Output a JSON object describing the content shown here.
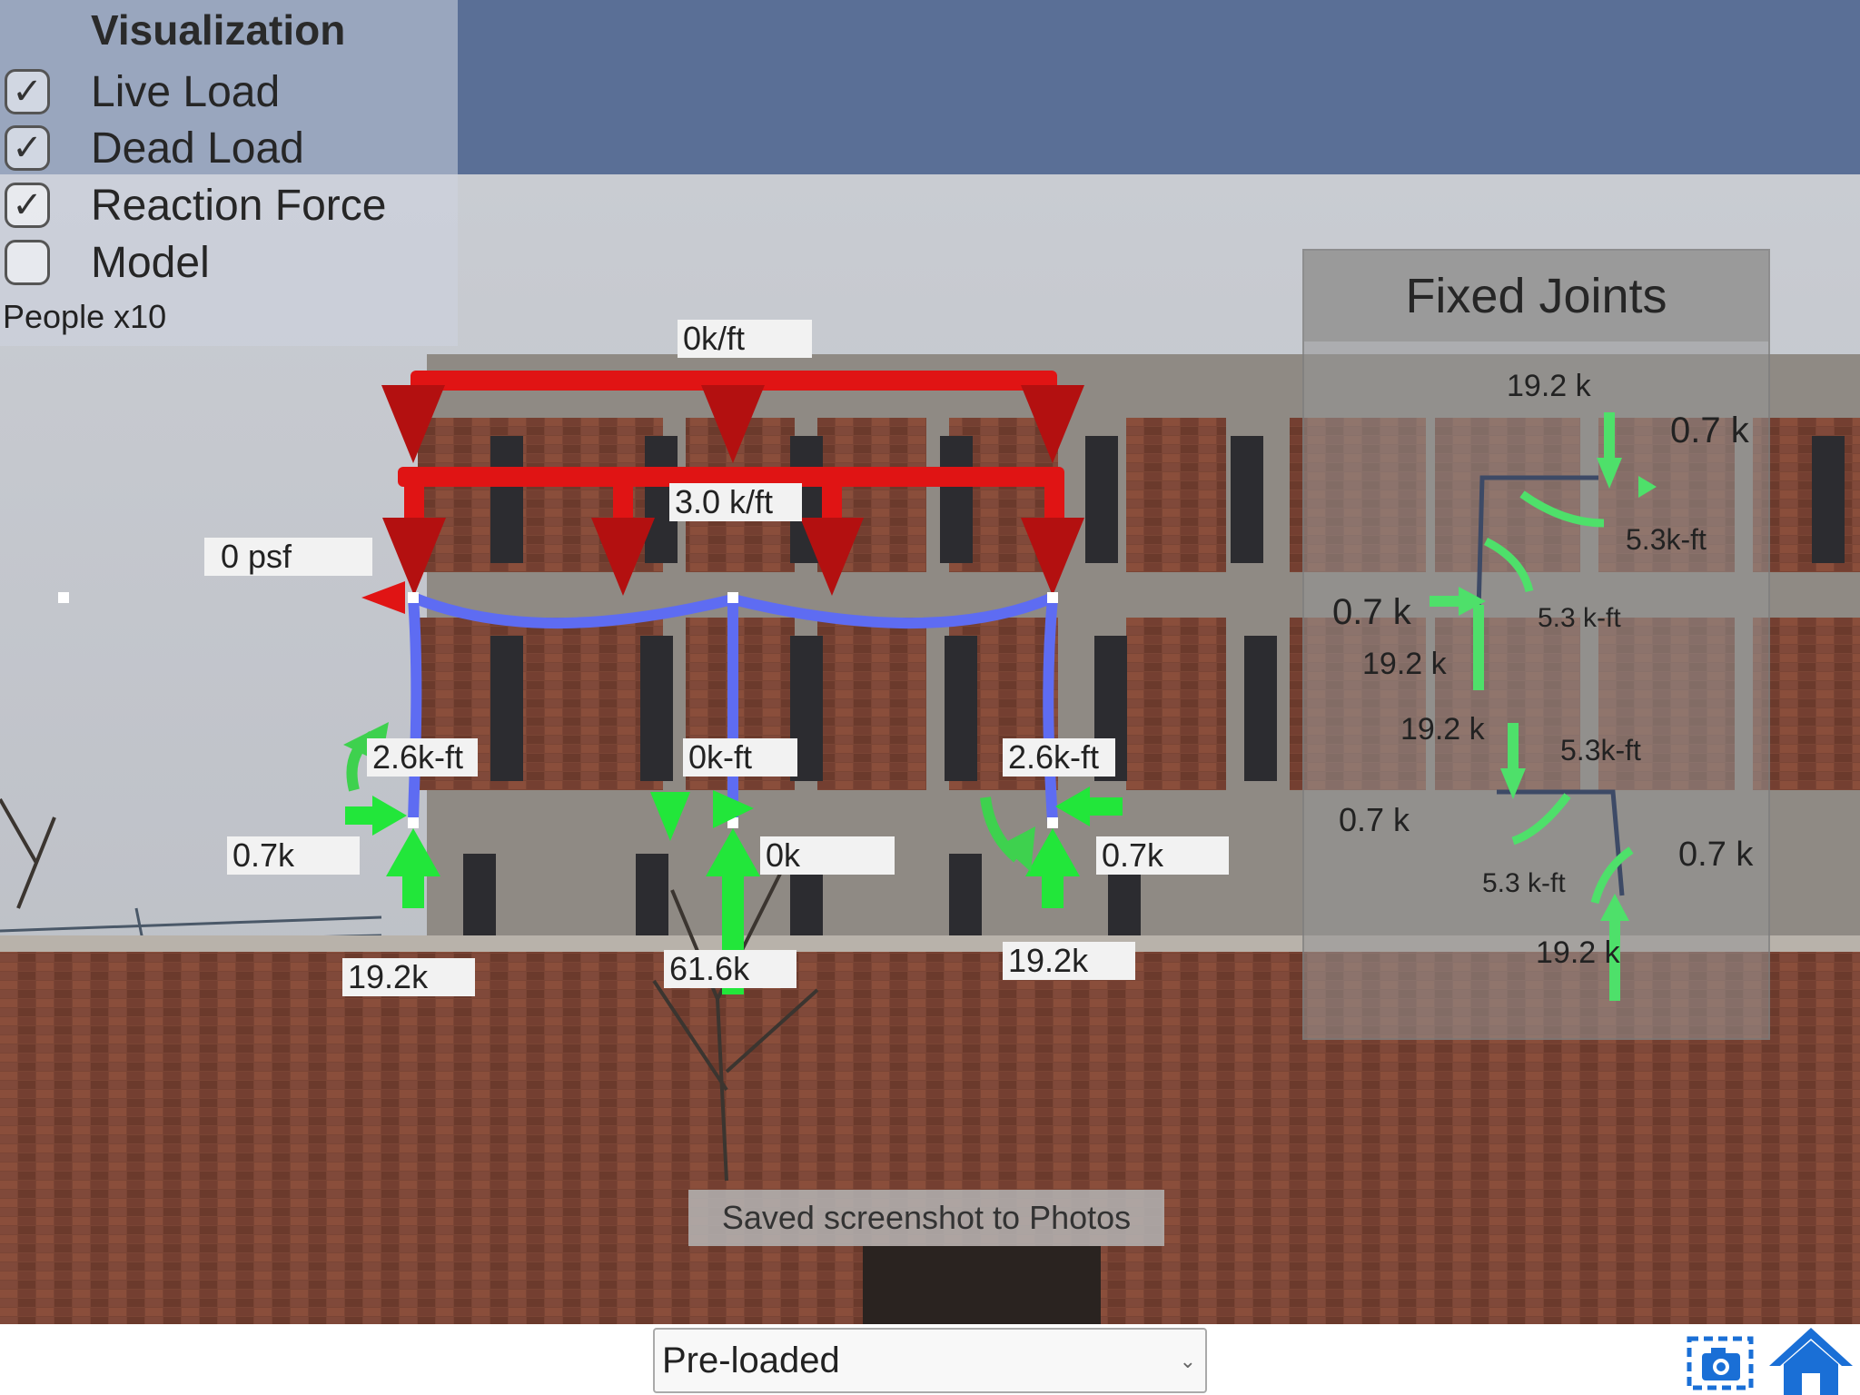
{
  "visualization": {
    "title": "Visualization",
    "options": [
      {
        "label": "Live Load",
        "checked": true
      },
      {
        "label": "Dead Load",
        "checked": true
      },
      {
        "label": "Reaction Force",
        "checked": true
      },
      {
        "label": "Model",
        "checked": false
      }
    ],
    "people": "People x10"
  },
  "frame_labels": {
    "top_load": "0k/ft",
    "mid_load": "3.0 k/ft",
    "wind_load": "0 psf",
    "left_moment": "2.6k-ft",
    "center_moment": "0k-ft",
    "right_moment": "2.6k-ft",
    "left_horizontal": "0.7k",
    "center_horizontal": "0k",
    "right_horizontal": "0.7k",
    "left_vertical": "19.2k",
    "center_vertical": "61.6k",
    "right_vertical": "19.2k"
  },
  "fixed_joints": {
    "title": "Fixed Joints",
    "upper": {
      "v_top": "19.2 k",
      "h_right": "0.7 k",
      "m_right": "5.3k-ft",
      "h_left": "0.7 k",
      "m_left": "5.3 k-ft",
      "v_left": "19.2 k"
    },
    "lower": {
      "v_top": "19.2 k",
      "m_top": "5.3k-ft",
      "h_left": "0.7 k",
      "h_right": "0.7 k",
      "m_bottom": "5.3 k-ft",
      "v_bottom": "19.2 k"
    }
  },
  "toast": "Saved screenshot to Photos",
  "bottom": {
    "selected_model": "Pre-loaded"
  },
  "icons": {
    "camera": "camera-icon",
    "home": "home-icon",
    "chevron": "chevron-down-icon"
  },
  "colors": {
    "load_red": "#e01414",
    "reaction_green": "#22e63a",
    "frame_blue": "#5e6cf2",
    "sky_band": "#5a6f96",
    "brick": "#7a4030",
    "home_blue": "#1a6fd6"
  }
}
